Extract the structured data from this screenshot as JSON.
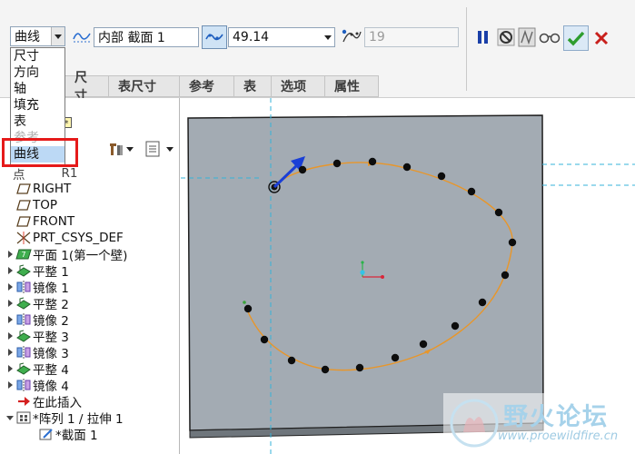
{
  "dashboard": {
    "type_combo": {
      "value": "曲线"
    },
    "location_field": {
      "value": "内部 截面 1"
    },
    "spacing_combo": {
      "value": "49.14"
    },
    "number_field": {
      "value": "19"
    }
  },
  "dropdown": {
    "items": [
      "尺寸",
      "方向",
      "轴",
      "填充",
      "表",
      "参考",
      "曲线"
    ],
    "selected_index": 6
  },
  "tabs": [
    "尺寸",
    "表尺寸",
    "参考",
    "表",
    "选项",
    "属性"
  ],
  "tree": {
    "partial_header": "点",
    "partial_header_suffix": "R1",
    "items": [
      {
        "label": "RIGHT",
        "icon": "datum-plane-icon",
        "expandable": false
      },
      {
        "label": "TOP",
        "icon": "datum-plane-icon",
        "expandable": false
      },
      {
        "label": "FRONT",
        "icon": "datum-plane-icon",
        "expandable": false
      },
      {
        "label": "PRT_CSYS_DEF",
        "icon": "coordinate-system-icon",
        "expandable": false
      },
      {
        "label": "平面 1(第一个壁)",
        "icon": "sheetmetal-wall-icon",
        "expandable": true
      },
      {
        "label": "平整 1",
        "icon": "flat-wall-icon",
        "expandable": true
      },
      {
        "label": "镜像 1",
        "icon": "mirror-icon",
        "expandable": true
      },
      {
        "label": "平整 2",
        "icon": "flat-wall-icon",
        "expandable": true
      },
      {
        "label": "镜像 2",
        "icon": "mirror-icon",
        "expandable": true
      },
      {
        "label": "平整 3",
        "icon": "flat-wall-icon",
        "expandable": true
      },
      {
        "label": "镜像 3",
        "icon": "mirror-icon",
        "expandable": true
      },
      {
        "label": "平整 4",
        "icon": "flat-wall-icon",
        "expandable": true
      },
      {
        "label": "镜像 4",
        "icon": "mirror-icon",
        "expandable": true
      },
      {
        "label": "在此插入",
        "icon": "insert-here-arrow-icon",
        "expandable": false
      },
      {
        "label": "*阵列 1 / 拉伸 1",
        "icon": "pattern-icon",
        "expandable": true,
        "expanded": true
      },
      {
        "label": "*截面 1",
        "icon": "sketch-icon",
        "expandable": false,
        "child": true
      }
    ]
  },
  "watermark": {
    "title": "野火论坛",
    "url": "www.proewildfire.cn"
  },
  "colors": {
    "accent_blue": "#1a3fd6",
    "curve_orange": "#e8962a",
    "sheet_gray": "#a3abb3",
    "confirm_green": "#2e9d2e",
    "cancel_red": "#c8201c",
    "highlight_red": "#e51a1a"
  }
}
